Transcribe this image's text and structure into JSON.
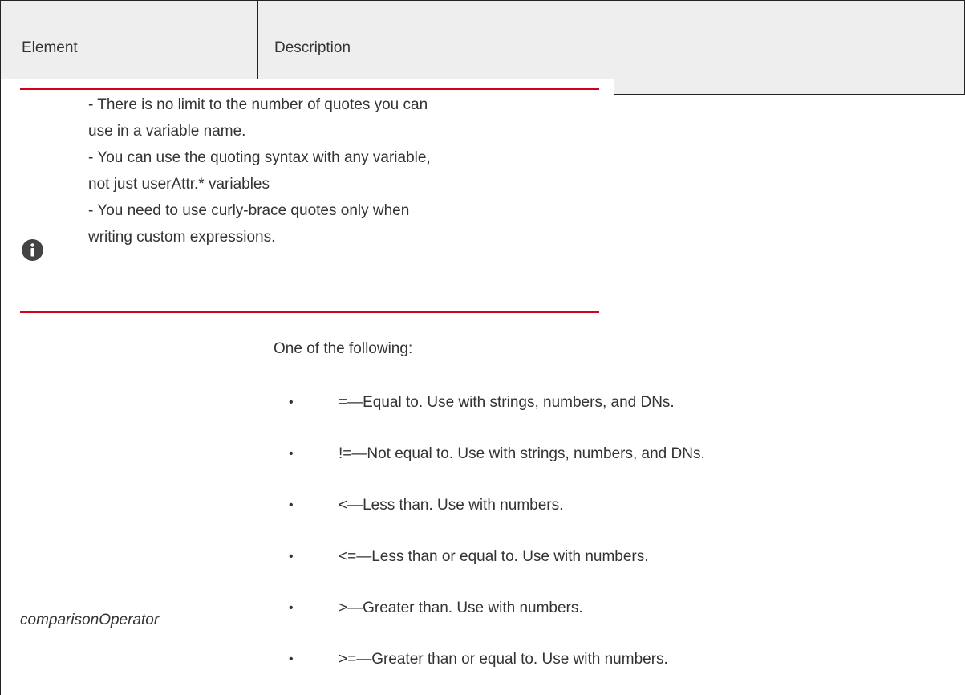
{
  "table": {
    "header": {
      "element": "Element",
      "description": "Description"
    },
    "note": {
      "icon": "info-icon",
      "accent_color": "#d0021b",
      "lines": [
        "- There is no limit to the number of quotes you can",
        "use in a variable name.",
        "- You can use the quoting syntax with any variable,",
        "not just userAttr.* variables",
        "- You need to use curly-brace quotes only when",
        "writing custom expressions."
      ]
    },
    "row": {
      "element": "comparisonOperator",
      "intro": "One of the following:",
      "bullet": "•",
      "operators": [
        "=—Equal to. Use with strings, numbers, and DNs.",
        "!=—Not equal to. Use with strings, numbers, and DNs.",
        "<—Less than. Use with numbers.",
        "<=—Less than or equal to. Use with numbers.",
        ">—Greater than. Use with numbers.",
        ">=—Greater than or equal to. Use with numbers."
      ]
    }
  }
}
